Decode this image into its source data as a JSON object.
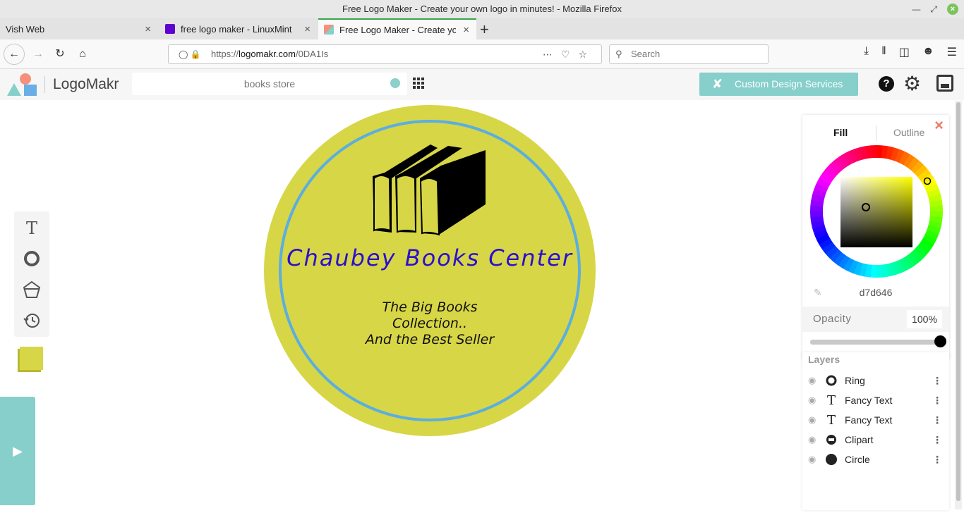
{
  "window": {
    "title": "Free Logo Maker - Create your own logo in minutes! - Mozilla Firefox"
  },
  "tabs": [
    {
      "label": "Vish Web",
      "active": false
    },
    {
      "label": "free logo maker - LinuxMint",
      "active": false
    },
    {
      "label": "Free Logo Maker - Create your own logo",
      "active": true
    }
  ],
  "nav": {
    "url_prefix": "https://",
    "url_domain": "logomakr.com",
    "url_path": "/0DA1Is",
    "search_placeholder": "Search"
  },
  "app": {
    "brand": "LogoMakr",
    "search_value": "books store",
    "custom_services_label": "Custom Design Services",
    "help_label": "?"
  },
  "logo": {
    "title": "Chaubey Books Center",
    "tagline_1": "The Big Books",
    "tagline_2": "Collection..",
    "tagline_3": "And the Best Seller",
    "fill_color": "#d7d646",
    "ring_color": "#5aaee0",
    "title_color": "#2a0fd0"
  },
  "color_panel": {
    "tab_fill": "Fill",
    "tab_outline": "Outline",
    "hex": "d7d646",
    "opacity_label": "Opacity",
    "opacity_value": "100%",
    "opacity_fraction": 1.0
  },
  "layers": {
    "heading": "Layers",
    "items": [
      {
        "name": "Ring",
        "icon": "ring-icon"
      },
      {
        "name": "Fancy Text",
        "icon": "text-icon"
      },
      {
        "name": "Fancy Text",
        "icon": "text-icon"
      },
      {
        "name": "Clipart",
        "icon": "clipart-icon"
      },
      {
        "name": "Circle",
        "icon": "circle-icon"
      }
    ]
  }
}
